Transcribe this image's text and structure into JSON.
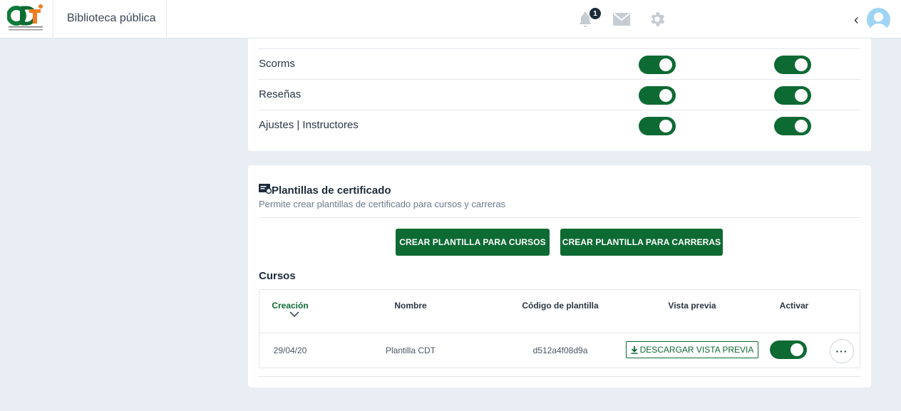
{
  "header": {
    "app_title": "Biblioteca pública",
    "notification_count": "1",
    "back_label": "‹"
  },
  "permissions": {
    "rows": [
      {
        "label": "Scorms"
      },
      {
        "label": "Reseñas"
      },
      {
        "label": "Ajustes | Instructores"
      }
    ]
  },
  "certificates": {
    "title": "Plantillas de certificado",
    "subtitle": "Permite crear plantillas de certificado para cursos y carreras",
    "create_courses_label": "CREAR PLANTILLA PARA CURSOS",
    "create_careers_label": "CREAR PLANTILLA PARA CARRERAS",
    "courses_title": "Cursos",
    "columns": [
      "Creación",
      "Nombre",
      "Código de plantilla",
      "Vista previa",
      "Activar"
    ],
    "rows": [
      {
        "date": "29/04/20",
        "name": "Plantilla CDT",
        "code": "d512a4f08d9a",
        "preview_label": "DESCARGAR VISTA PREVIA",
        "more_label": "···"
      }
    ]
  },
  "colors": {
    "accent_green": "#0e6a33",
    "background": "#e9eef5",
    "logo_green": "#0e7a3a",
    "logo_orange": "#f07c1e"
  }
}
